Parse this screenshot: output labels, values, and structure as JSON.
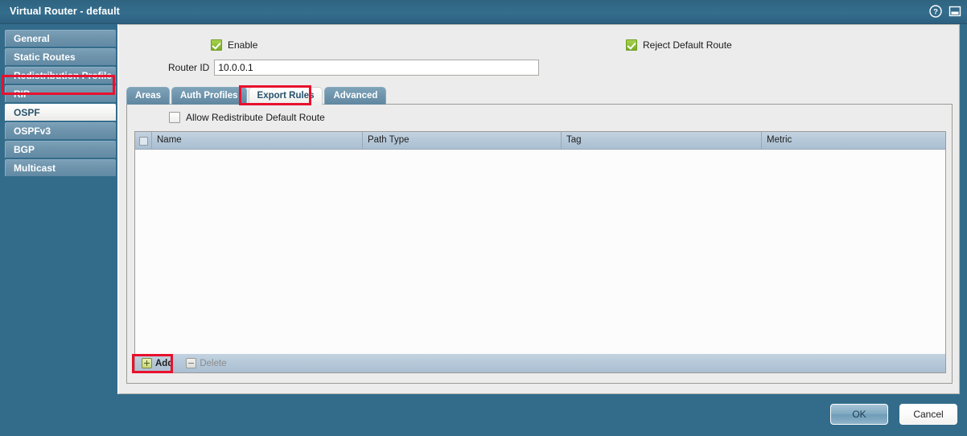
{
  "window": {
    "title": "Virtual Router - default",
    "icons": [
      {
        "name": "help-icon",
        "glyph": "?"
      },
      {
        "name": "minimize-icon",
        "glyph": "▭"
      }
    ]
  },
  "sidebar": {
    "items": [
      {
        "label": "General",
        "selected": false
      },
      {
        "label": "Static Routes",
        "selected": false
      },
      {
        "label": "Redistribution Profile",
        "selected": false
      },
      {
        "label": "RIP",
        "selected": false
      },
      {
        "label": "OSPF",
        "selected": true
      },
      {
        "label": "OSPFv3",
        "selected": false
      },
      {
        "label": "BGP",
        "selected": false
      },
      {
        "label": "Multicast",
        "selected": false
      }
    ],
    "highlighted_item": "OSPF"
  },
  "main": {
    "enable": {
      "label": "Enable",
      "checked": true
    },
    "reject_default_route": {
      "label": "Reject Default Route",
      "checked": true
    },
    "router_id": {
      "label": "Router ID",
      "value": "10.0.0.1",
      "placeholder": ""
    },
    "tabs": [
      {
        "label": "Areas",
        "active": false
      },
      {
        "label": "Auth Profiles",
        "active": false
      },
      {
        "label": "Export Rules",
        "active": true
      },
      {
        "label": "Advanced",
        "active": false
      }
    ],
    "highlighted_tab": "Export Rules",
    "allow_redistribute": {
      "label": "Allow Redistribute Default Route",
      "checked": false
    },
    "table": {
      "columns": [
        "Name",
        "Path Type",
        "Tag",
        "Metric"
      ],
      "rows": [],
      "select_all_checked": false
    },
    "table_buttons": {
      "add": {
        "label": "Add",
        "icon": "plus-icon",
        "enabled": true,
        "highlighted": true
      },
      "delete": {
        "label": "Delete",
        "icon": "minus-icon",
        "enabled": false,
        "highlighted": false
      }
    }
  },
  "footer": {
    "ok_label": "OK",
    "cancel_label": "Cancel"
  },
  "colors": {
    "chrome_blue": "#336c8b",
    "sidebar_item": "#6d93ab",
    "highlight_red": "#e8112d",
    "checkbox_green": "#8ebf36",
    "panel_gray": "#ececec",
    "table_header": "#b4c7d8"
  }
}
